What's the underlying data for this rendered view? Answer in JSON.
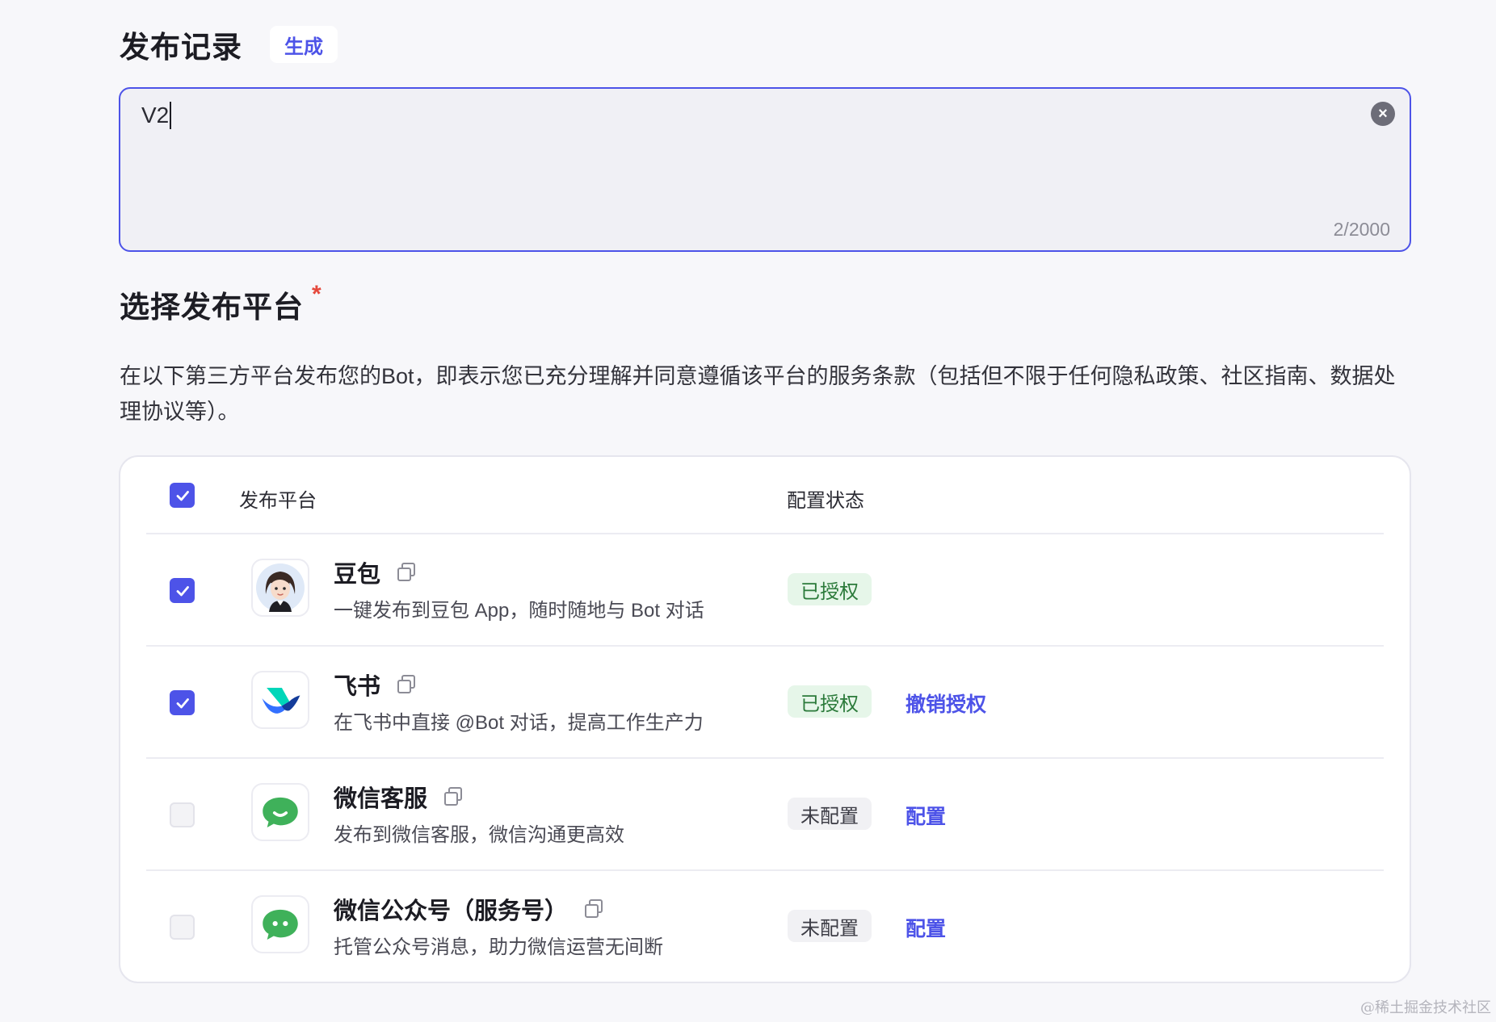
{
  "release": {
    "title": "发布记录",
    "generate_label": "生成",
    "input_value": "V2",
    "char_count": "2/2000"
  },
  "platform_section": {
    "title": "选择发布平台",
    "required_mark": "*",
    "terms": "在以下第三方平台发布您的Bot，即表示您已充分理解并同意遵循该平台的服务条款（包括但不限于任何隐私政策、社区指南、数据处理协议等）。"
  },
  "table": {
    "header": {
      "select_all_checked": true,
      "col_platform": "发布平台",
      "col_status": "配置状态"
    },
    "rows": [
      {
        "name": "豆包",
        "desc": "一键发布到豆包 App，随时随地与 Bot 对话",
        "icon": "doubao-avatar-icon",
        "checked": true,
        "status": "已授权",
        "action": ""
      },
      {
        "name": "飞书",
        "desc": "在飞书中直接 @Bot 对话，提高工作生产力",
        "icon": "feishu-logo-icon",
        "checked": true,
        "status": "已授权",
        "action": "撤销授权"
      },
      {
        "name": "微信客服",
        "desc": "发布到微信客服，微信沟通更高效",
        "icon": "wechat-service-icon",
        "checked": false,
        "status": "未配置",
        "action": "配置"
      },
      {
        "name": "微信公众号（服务号）",
        "desc": "托管公众号消息，助力微信运营无间断",
        "icon": "wechat-official-icon",
        "checked": false,
        "status": "未配置",
        "action": "配置"
      }
    ]
  },
  "watermark": "@稀土掘金技术社区",
  "colors": {
    "accent": "#4d53e8",
    "authorized_bg": "#e6f6e9",
    "authorized_text": "#2b7a3a",
    "required": "#e5483b",
    "wechat_green": "#3fb15a"
  }
}
